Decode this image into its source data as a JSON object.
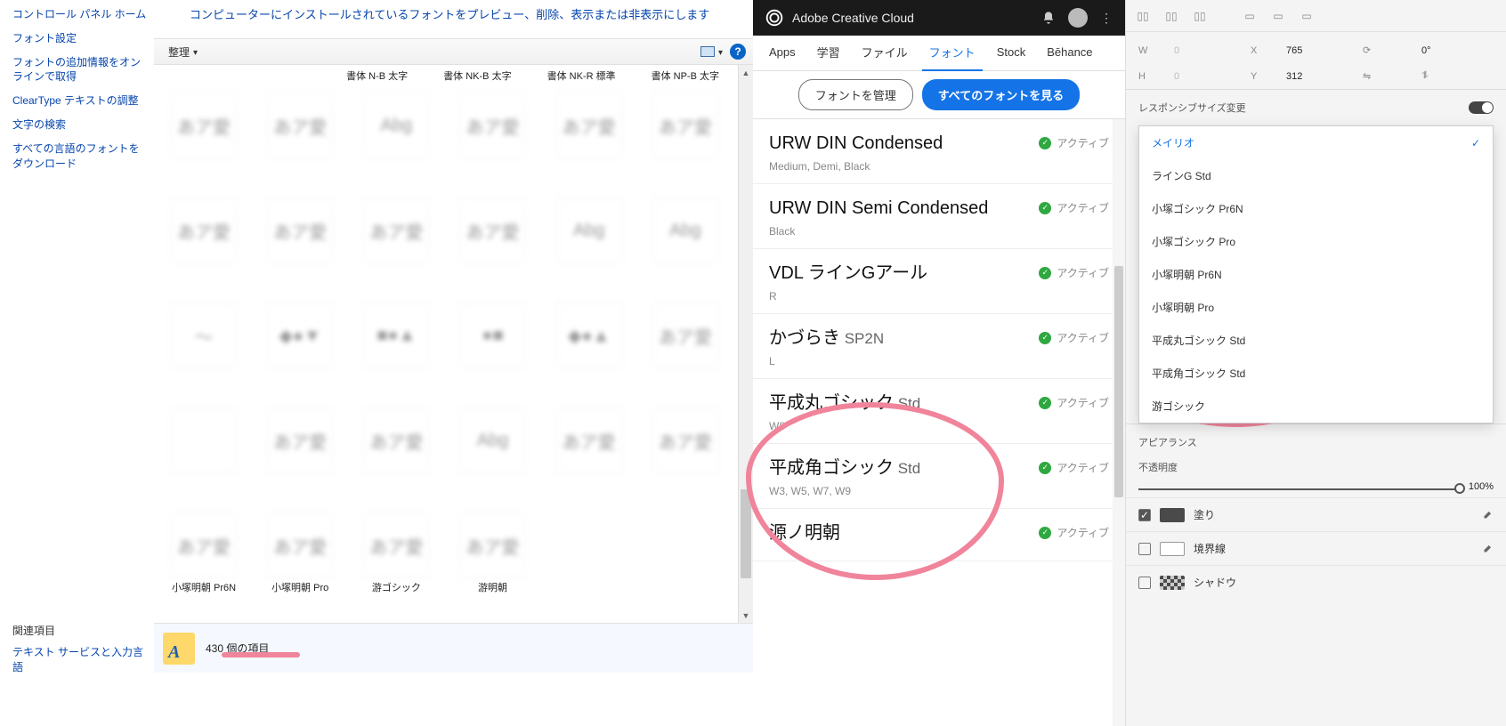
{
  "cp": {
    "home": "コントロール パネル ホーム",
    "links": [
      "フォント設定",
      "フォントの追加情報をオンラインで取得",
      "ClearType テキストの調整",
      "文字の検索",
      "すべての言語のフォントをダウンロード"
    ],
    "related_header": "関連項目",
    "related": [
      "テキスト サービスと入力言語"
    ],
    "description": "コンピューターにインストールされているフォントをプレビュー、削除、表示または非表示にします",
    "toolbar": {
      "organize": "整理"
    },
    "header_row": [
      "書体 N-B 太字",
      "書体 NK-B 太字",
      "書体 NK-R 標準",
      "書体 NP-B 太字"
    ],
    "tiles": [
      {
        "g": "あア愛",
        "l": ""
      },
      {
        "g": "あア愛",
        "l": ""
      },
      {
        "g": "Abg",
        "l": ""
      },
      {
        "g": "あア愛",
        "l": ""
      },
      {
        "g": "あア愛",
        "l": ""
      },
      {
        "g": "あア愛",
        "l": ""
      },
      {
        "g": "あア愛",
        "l": ""
      },
      {
        "g": "あア愛",
        "l": ""
      },
      {
        "g": "あア愛",
        "l": ""
      },
      {
        "g": "あア愛",
        "l": ""
      },
      {
        "g": "Abg",
        "l": ""
      },
      {
        "g": "Abg",
        "l": ""
      },
      {
        "g": "〜",
        "l": ""
      },
      {
        "g": "◆●▼",
        "l": ""
      },
      {
        "g": "■●▲",
        "l": ""
      },
      {
        "g": "●■",
        "l": ""
      },
      {
        "g": "◆●▲",
        "l": ""
      },
      {
        "g": "あア愛",
        "l": ""
      },
      {
        "g": "",
        "l": ""
      },
      {
        "g": "あア愛",
        "l": ""
      },
      {
        "g": "あア愛",
        "l": ""
      },
      {
        "g": "Abg",
        "l": ""
      },
      {
        "g": "あア愛",
        "l": ""
      },
      {
        "g": "あア愛",
        "l": ""
      },
      {
        "g": "あア愛",
        "l": "小塚明朝 Pr6N",
        "sharp": true
      },
      {
        "g": "あア愛",
        "l": "小塚明朝 Pro",
        "sharp": true
      },
      {
        "g": "あア愛",
        "l": "游ゴシック",
        "sharp": true
      },
      {
        "g": "あア愛",
        "l": "游明朝",
        "sharp": true
      }
    ],
    "status_count": "430 個の項目"
  },
  "cc": {
    "title": "Adobe Creative Cloud",
    "tabs": [
      "Apps",
      "学習",
      "ファイル",
      "フォント",
      "Stock",
      "Bēhance"
    ],
    "active_tab": 3,
    "btn_manage": "フォントを管理",
    "btn_seeall": "すべてのフォントを見る",
    "status_active": "アクティブ",
    "fonts": [
      {
        "name": "URW DIN Condensed",
        "suffix": "",
        "sub": "Medium, Demi, Black"
      },
      {
        "name": "URW DIN Semi Condensed",
        "suffix": "",
        "sub": "Black"
      },
      {
        "name": "VDL ラインGアール",
        "suffix": "",
        "sub": "R"
      },
      {
        "name": "かづらき",
        "suffix": " SP2N",
        "sub": "L"
      },
      {
        "name": "平成丸ゴシック",
        "suffix": " Std",
        "sub": "W8"
      },
      {
        "name": "平成角ゴシック",
        "suffix": " Std",
        "sub": "W3, W5, W7, W9"
      },
      {
        "name": "源ノ明朝",
        "suffix": "",
        "sub": ""
      }
    ]
  },
  "xd": {
    "W": "W",
    "Wval": "0",
    "X": "X",
    "Xval": "765",
    "rot": "0°",
    "H": "H",
    "Hval": "0",
    "Y": "Y",
    "Yval": "312",
    "responsive_label": "レスポンシブサイズ変更",
    "dd_items": [
      "メイリオ",
      "ラインG Std",
      "小塚ゴシック Pr6N",
      "小塚ゴシック Pro",
      "小塚明朝 Pr6N",
      "小塚明朝 Pro",
      "平成丸ゴシック Std",
      "平成角ゴシック Std",
      "游ゴシック"
    ],
    "dd_selected": 0,
    "appearance_label": "アピアランス",
    "opacity_label": "不透明度",
    "opacity_pct": "100%",
    "fill_label": "塗り",
    "stroke_label": "境界線",
    "shadow_label": "シャドウ"
  }
}
